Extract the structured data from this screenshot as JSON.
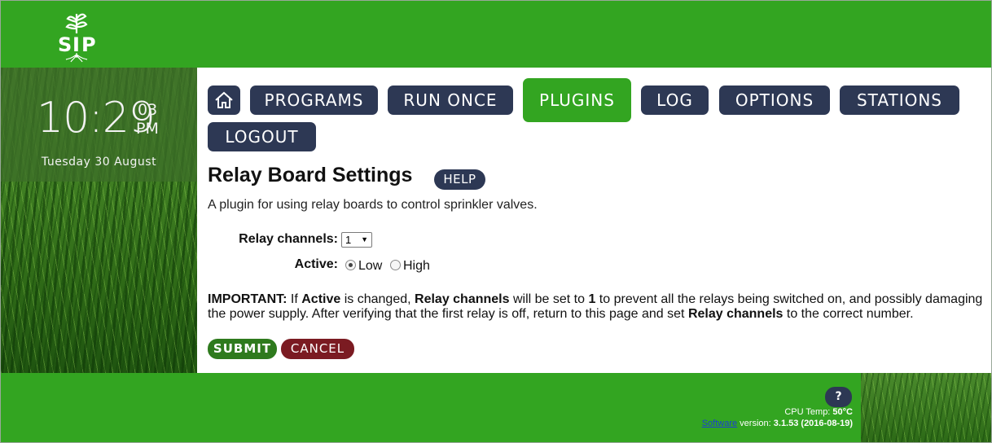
{
  "clock": {
    "time": "10:29",
    "seconds": "03",
    "ampm": "PM",
    "date": "Tuesday 30 August"
  },
  "nav": {
    "items": [
      {
        "label": "PROGRAMS"
      },
      {
        "label": "RUN ONCE"
      },
      {
        "label": "PLUGINS"
      },
      {
        "label": "LOG"
      },
      {
        "label": "OPTIONS"
      },
      {
        "label": "STATIONS"
      },
      {
        "label": "LOGOUT"
      }
    ],
    "active": "PLUGINS"
  },
  "page": {
    "title": "Relay Board Settings",
    "help_label": "HELP",
    "description": "A plugin for using relay boards to control sprinkler valves."
  },
  "form": {
    "relay_channels_label": "Relay channels:",
    "relay_channels_value": "1",
    "active_label": "Active:",
    "active_options": [
      "Low",
      "High"
    ],
    "active_selected": "Low"
  },
  "important": {
    "lead": "IMPORTANT:",
    "t1": " If ",
    "b1": "Active",
    "t2": " is changed, ",
    "b2": "Relay channels",
    "t3": " will be set to ",
    "b3": "1",
    "t4": " to prevent all the relays being switched on, and possibly damaging the power supply. After verifying that the first relay is off, return to this page and set ",
    "b4": "Relay channels",
    "t5": " to the correct number."
  },
  "buttons": {
    "submit": "SUBMIT",
    "cancel": "CANCEL"
  },
  "footer": {
    "help_label": "?",
    "cpu_label": "CPU Temp: ",
    "cpu_value": "50°C",
    "software_link": "Software",
    "version_label": " version: ",
    "version_value": "3.1.53 (2016-08-19)"
  },
  "colors": {
    "header_green": "#33a521",
    "nav_navy": "#2d3854",
    "submit_green": "#2e7a1d",
    "cancel_red": "#7b1b22"
  },
  "icons": {
    "logo": "sip-logo-icon",
    "home": "home-icon"
  }
}
